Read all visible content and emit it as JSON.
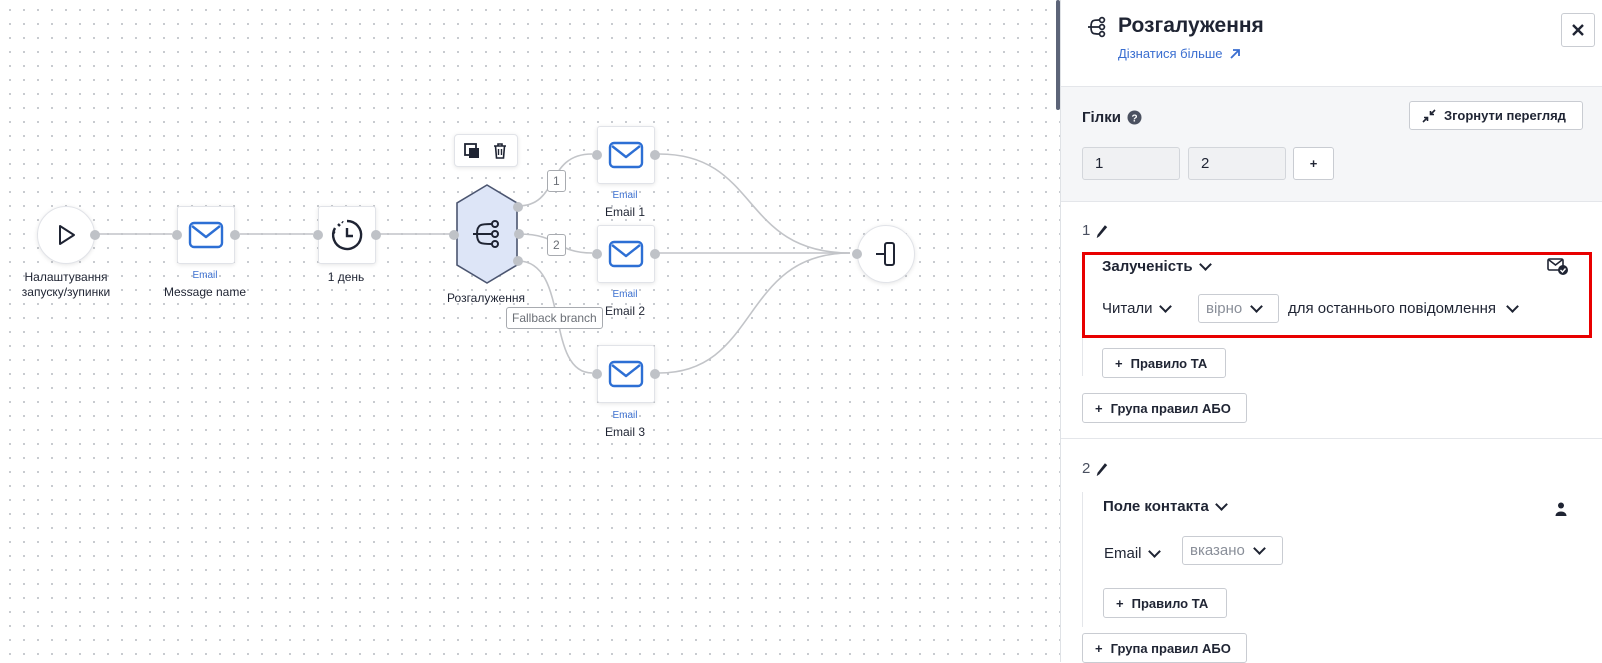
{
  "canvas": {
    "nodes": {
      "start": {
        "label_line1": "Налаштування",
        "label_line2": "запуску/зупинки"
      },
      "email_main": {
        "type": "Email",
        "label": "Message name"
      },
      "delay": {
        "label": "1 день"
      },
      "branch": {
        "label": "Розгалуження"
      },
      "email1": {
        "type": "Email",
        "label": "Email 1"
      },
      "email2": {
        "type": "Email",
        "label": "Email 2"
      },
      "email3": {
        "type": "Email",
        "label": "Email 3"
      }
    },
    "branch_tags": {
      "b1": "1",
      "b2": "2",
      "fallback": "Fallback branch"
    },
    "colors": {
      "accent": "#3a6ed0",
      "edge": "#c2c4c8",
      "branch_fill": "#dde5f7"
    }
  },
  "panel": {
    "title": "Розгалуження",
    "title_icon": "branch-icon",
    "learn_more": "Дізнатися більше",
    "branches_section": {
      "title": "Гілки",
      "collapse_label": "Згорнути перегляд",
      "branch_inputs": [
        "1",
        "2"
      ],
      "add_label": "+"
    },
    "branch1": {
      "number": "1",
      "rule_title": "Залученість",
      "condition": "Читали",
      "value": "вірно",
      "scope": "для останнього повідомлення",
      "and_label": "Правило ТА",
      "or_label": "Група правил АБО"
    },
    "branch2": {
      "number": "2",
      "rule_title": "Поле контакта",
      "condition": "Email",
      "value": "вказано",
      "and_label": "Правило ТА",
      "or_label": "Група правил АБО"
    },
    "highlight_color": "#e80000"
  }
}
